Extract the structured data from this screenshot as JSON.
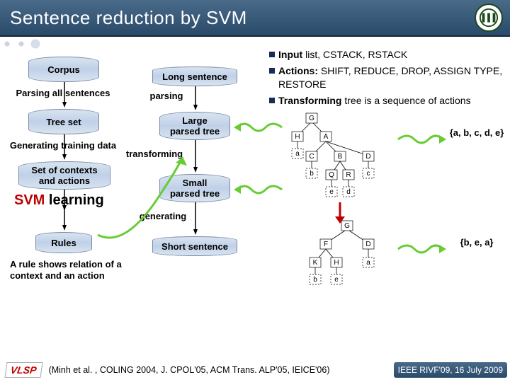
{
  "title": "Sentence reduction by SVM",
  "left": {
    "corpus": "Corpus",
    "parsing_all": "Parsing all sentences",
    "tree_set": "Tree set",
    "gen_training": "Generating training data",
    "set_contexts": "Set of contexts\nand actions",
    "svm": "SVM",
    "learning": "learning",
    "rules": "Rules",
    "rule_note": "A rule shows relation of a\ncontext and an action"
  },
  "mid": {
    "long_sentence": "Long sentence",
    "parsing": "parsing",
    "large_tree": "Large\nparsed tree",
    "transforming": "transforming",
    "small_tree": "Small\nparsed tree",
    "generating": "generating",
    "short_sentence": "Short sentence"
  },
  "bullets": {
    "input_head": "Input",
    "input_tail": " list, CSTACK, RSTACK",
    "actions_head": "Actions:",
    "actions_tail": " SHIFT, REDUCE, DROP, ASSIGN TYPE, RESTORE",
    "transform_head": "Transforming",
    "transform_tail": " tree is a sequence of actions"
  },
  "sets": {
    "a": "{a, b, c, d, e}",
    "b": "{b, e, a}"
  },
  "tree1": {
    "G": "G",
    "H": "H",
    "A": "A",
    "a": "a",
    "C": "C",
    "B": "B",
    "D": "D",
    "b": "b",
    "Q": "Q",
    "R": "R",
    "c": "c",
    "e": "e",
    "d": "d"
  },
  "tree2": {
    "G": "G",
    "F": "F",
    "D": "D",
    "K": "K",
    "H": "H",
    "a": "a",
    "b": "b",
    "e": "e"
  },
  "footer": {
    "vlsp": "VLSP",
    "citation": "(Minh et al. , COLING 2004, J. CPOL'05, ACM Trans. ALP'05, IEICE'06)",
    "badge": "IEEE RIVF'09, 16 July 2009"
  }
}
